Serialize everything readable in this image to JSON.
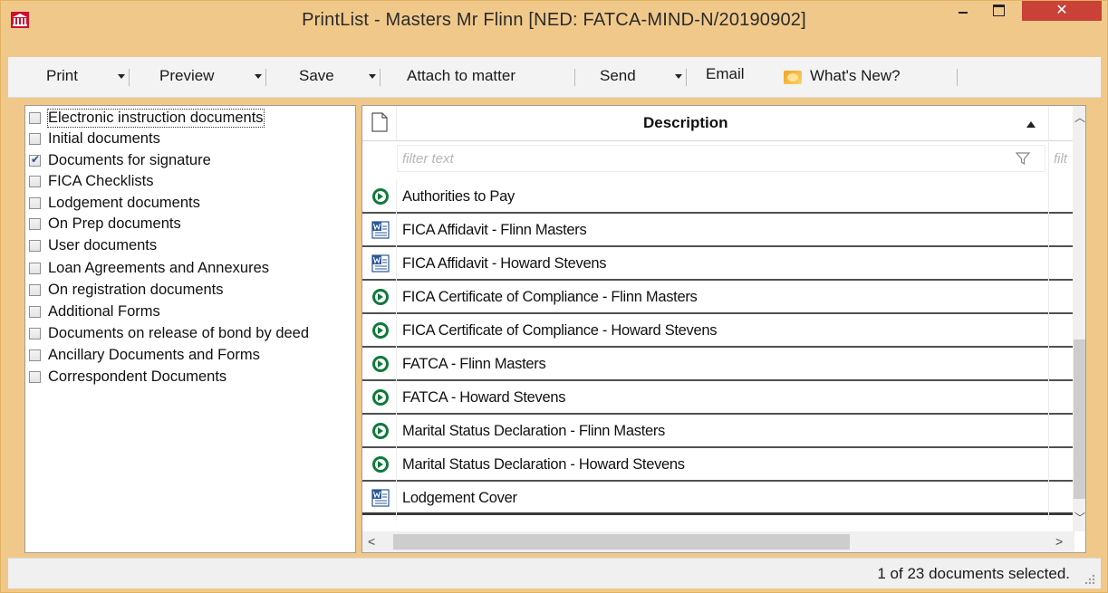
{
  "window": {
    "title": "PrintList - Masters Mr Flinn [NED: FATCA-MIND-N/20190902]",
    "close_glyph": "✕",
    "accent_color": "#f0c98a"
  },
  "toolbar": {
    "print": "Print",
    "preview": "Preview",
    "save": "Save",
    "attach": "Attach to matter",
    "send": "Send",
    "email": "Email",
    "whats_new": "What's New?"
  },
  "categories": [
    {
      "label": "Electronic instruction documents",
      "checked": false
    },
    {
      "label": "Initial documents",
      "checked": false
    },
    {
      "label": "Documents for signature",
      "checked": true
    },
    {
      "label": "FICA Checklists",
      "checked": false
    },
    {
      "label": "Lodgement documents",
      "checked": false
    },
    {
      "label": "On Prep documents",
      "checked": false
    },
    {
      "label": "User documents",
      "checked": false
    },
    {
      "label": "Loan Agreements and Annexures",
      "checked": false
    },
    {
      "label": "On registration documents",
      "checked": false
    },
    {
      "label": "Additional Forms",
      "checked": false
    },
    {
      "label": "Documents on release of bond by deed",
      "checked": false
    },
    {
      "label": "Ancillary Documents and Forms",
      "checked": false
    },
    {
      "label": "Correspondent Documents",
      "checked": false
    }
  ],
  "grid": {
    "column_header": "Description",
    "filter_placeholder": "filter text",
    "filter_placeholder_2": "filt",
    "rows": [
      {
        "icon": "green-form-icon",
        "text": "Authorities to Pay"
      },
      {
        "icon": "word-doc-icon",
        "text": "FICA Affidavit - Flinn Masters"
      },
      {
        "icon": "word-doc-icon",
        "text": "FICA Affidavit - Howard Stevens"
      },
      {
        "icon": "green-form-icon",
        "text": "FICA Certificate of Compliance - Flinn Masters"
      },
      {
        "icon": "green-form-icon",
        "text": "FICA Certificate of Compliance - Howard Stevens"
      },
      {
        "icon": "green-form-icon",
        "text": "FATCA - Flinn Masters"
      },
      {
        "icon": "green-form-icon",
        "text": "FATCA - Howard Stevens"
      },
      {
        "icon": "green-form-icon",
        "text": "Marital Status Declaration - Flinn Masters"
      },
      {
        "icon": "green-form-icon",
        "text": "Marital Status Declaration - Howard Stevens"
      },
      {
        "icon": "word-doc-icon",
        "text": "Lodgement Cover"
      }
    ]
  },
  "status": {
    "text": "1 of 23 documents selected."
  }
}
